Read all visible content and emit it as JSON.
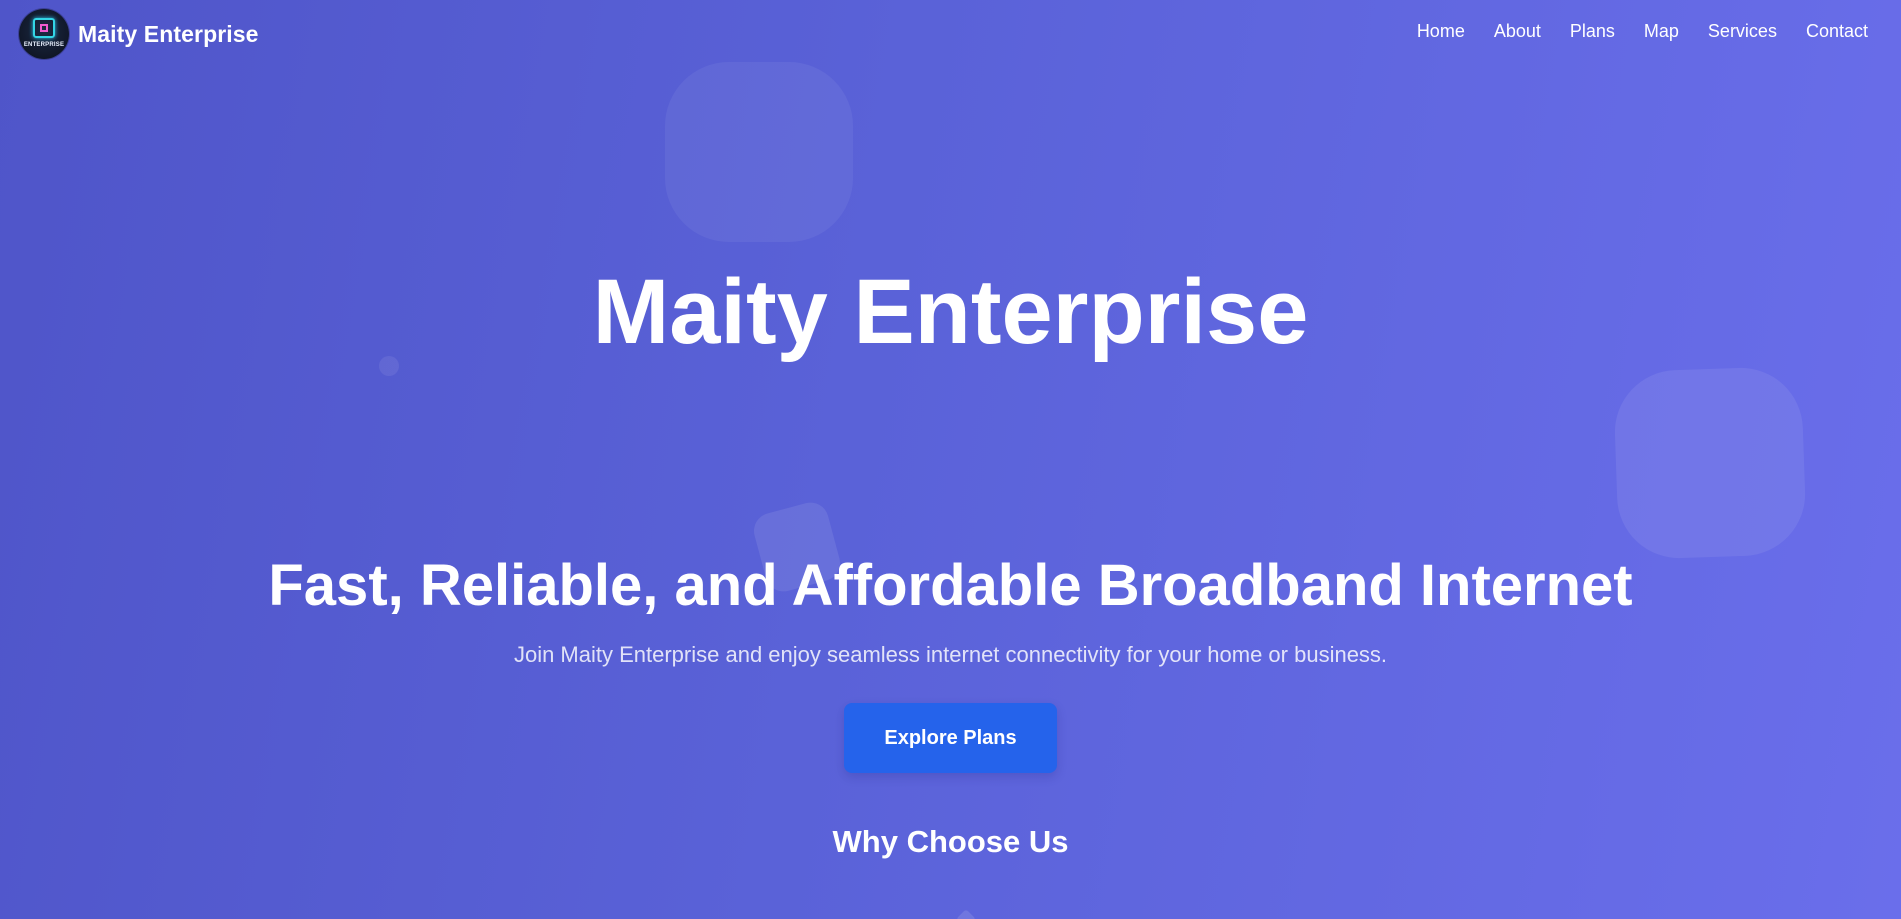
{
  "header": {
    "brand_name": "Maity Enterprise",
    "logo_text": "ENTERPRISE",
    "nav": [
      {
        "label": "Home"
      },
      {
        "label": "About"
      },
      {
        "label": "Plans"
      },
      {
        "label": "Map"
      },
      {
        "label": "Services"
      },
      {
        "label": "Contact"
      }
    ]
  },
  "hero": {
    "title": "Maity Enterprise",
    "tagline": "Fast, Reliable, and Affordable Broadband Internet",
    "subtitle": "Join Maity Enterprise and enjoy seamless internet connectivity for your home or business.",
    "cta_label": "Explore Plans"
  },
  "why_section": {
    "heading": "Why Choose Us"
  },
  "colors": {
    "background_start": "#4f55c9",
    "background_end": "#6a6eeb",
    "cta_background": "#2563eb",
    "text": "#ffffff"
  },
  "icons": {
    "logo": "chip-logo-icon"
  }
}
